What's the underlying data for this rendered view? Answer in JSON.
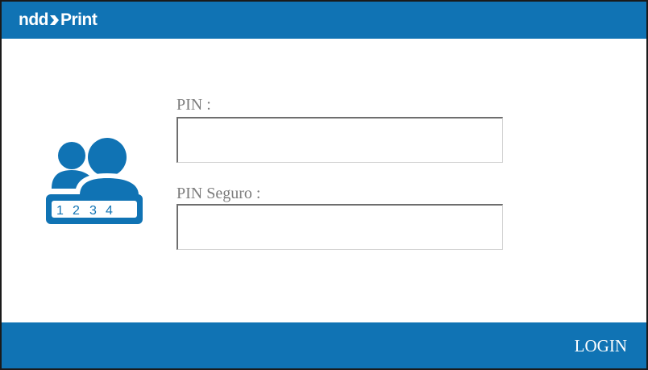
{
  "header": {
    "logo_text_left": "ndd",
    "logo_text_right": "Print",
    "background_color": "#1073b4"
  },
  "icon": {
    "name": "users-pin-icon",
    "digits": [
      "1",
      "2",
      "3",
      "4"
    ],
    "color": "#1073b4"
  },
  "form": {
    "pin_label": "PIN :",
    "pin_value": "",
    "pin_seguro_label": "PIN Seguro :",
    "pin_seguro_value": ""
  },
  "footer": {
    "login_label": "LOGIN",
    "background_color": "#1073b4"
  }
}
